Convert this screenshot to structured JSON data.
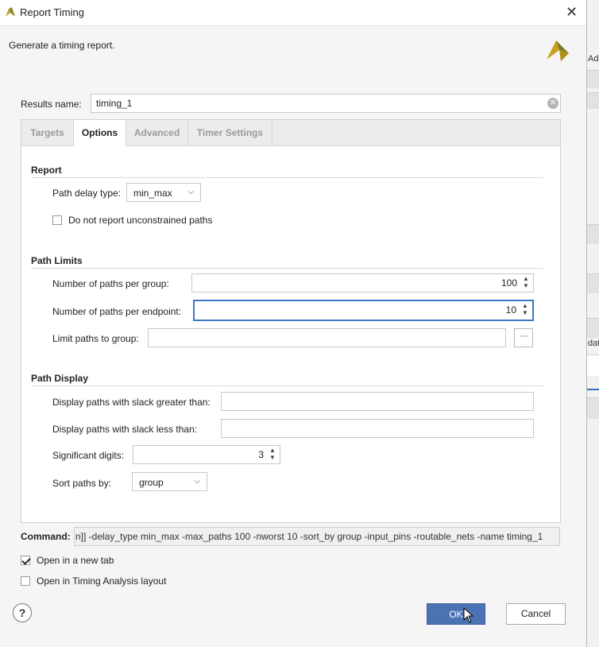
{
  "window": {
    "title": "Report Timing",
    "close_glyph": "✕"
  },
  "header": {
    "description": "Generate a timing report."
  },
  "results": {
    "label": "Results name:",
    "value": "timing_1"
  },
  "tabs": [
    {
      "label": "Targets",
      "active": false
    },
    {
      "label": "Options",
      "active": true
    },
    {
      "label": "Advanced",
      "active": false
    },
    {
      "label": "Timer Settings",
      "active": false
    }
  ],
  "report": {
    "title": "Report",
    "path_delay_label": "Path delay type:",
    "path_delay_value": "min_max",
    "unconstrained_label": "Do not report unconstrained paths",
    "unconstrained_checked": false
  },
  "path_limits": {
    "title": "Path Limits",
    "per_group_label": "Number of paths per group:",
    "per_group_value": "100",
    "per_endpoint_label": "Number of paths per endpoint:",
    "per_endpoint_value": "10",
    "limit_group_label": "Limit paths to group:",
    "limit_group_value": "",
    "browse_glyph": "···"
  },
  "path_display": {
    "title": "Path Display",
    "slack_greater_label": "Display paths with slack greater than:",
    "slack_greater_value": "",
    "slack_less_label": "Display paths with slack less than:",
    "slack_less_value": "",
    "sig_digits_label": "Significant digits:",
    "sig_digits_value": "3",
    "sort_label": "Sort paths by:",
    "sort_value": "group"
  },
  "command": {
    "label": "Command:",
    "text": "n]] -delay_type min_max -max_paths 100 -nworst 10 -sort_by group -input_pins -routable_nets -name timing_1"
  },
  "options": {
    "new_tab_label": "Open in a new tab",
    "new_tab_checked": true,
    "timing_layout_label": "Open in Timing Analysis layout",
    "timing_layout_checked": false
  },
  "buttons": {
    "help": "?",
    "ok": "OK",
    "cancel": "Cancel"
  },
  "background_app": {
    "text_top": "Ad",
    "text_mid": "dat"
  },
  "colors": {
    "accent": "#4b73b4",
    "focus": "#3b78c9",
    "brand": "#c8a11a"
  },
  "icons": {
    "app": "vivado-logo-icon",
    "brand": "vivado-logo-icon",
    "clear": "clear-circle-icon",
    "cursor": "mouse-pointer-icon"
  }
}
